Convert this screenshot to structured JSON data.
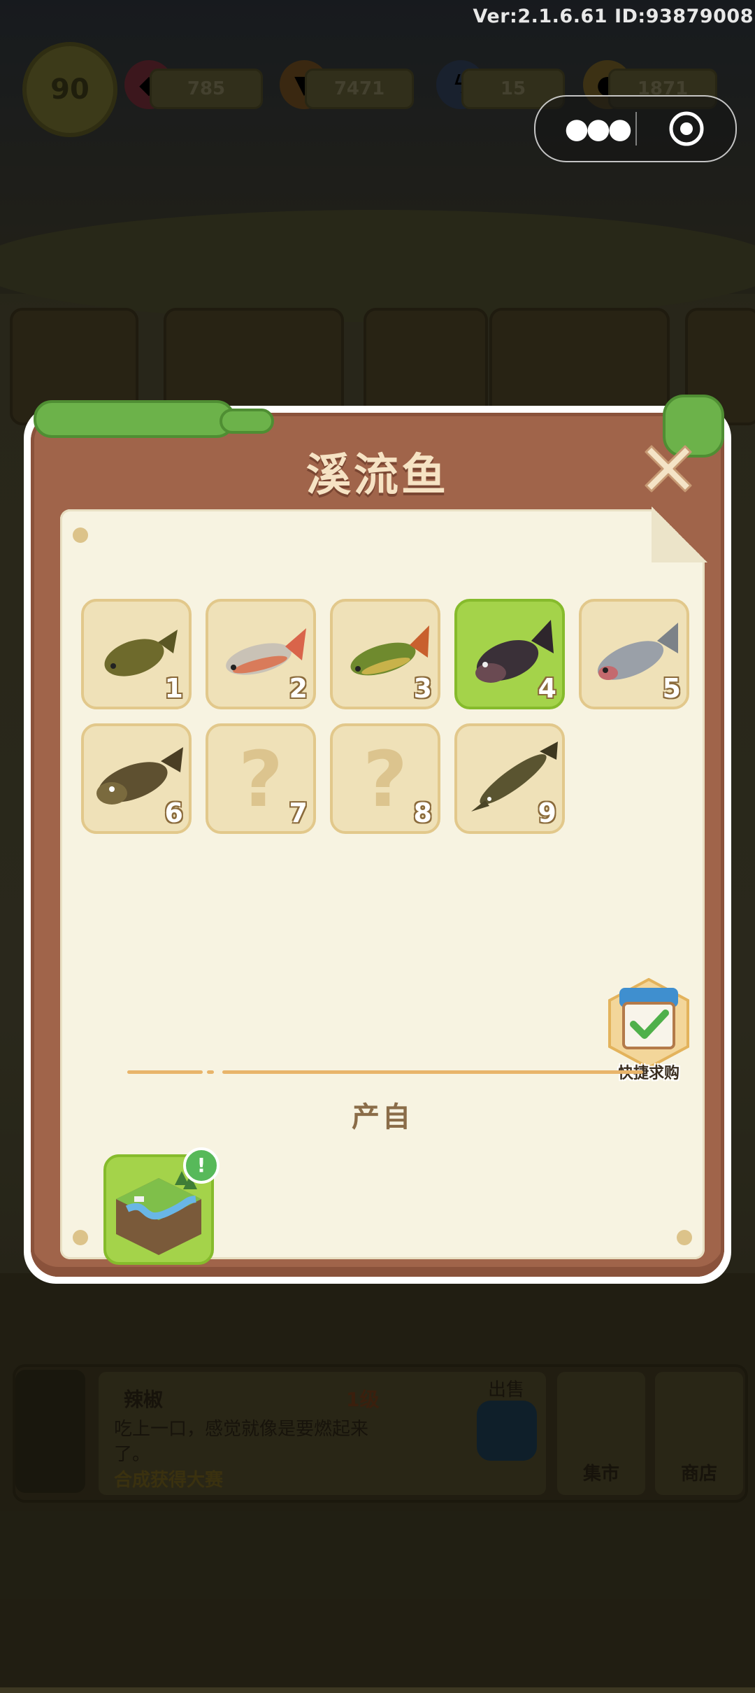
{
  "header": {
    "version_text": "Ver:2.1.6.61 ID:93879008",
    "level": "90",
    "resources": [
      {
        "name": "gem",
        "value": "785"
      },
      {
        "name": "carrot",
        "value": "7471"
      },
      {
        "name": "energy",
        "value": "15"
      },
      {
        "name": "coin",
        "value": "1871"
      }
    ]
  },
  "capsule": {
    "more_icon": "more-dots-icon",
    "close_icon": "target-close-icon"
  },
  "modal": {
    "title": "溪流鱼",
    "close_icon": "close-x-icon",
    "items": [
      {
        "number": "1",
        "status": "unlocked",
        "icon": "fish-1-icon"
      },
      {
        "number": "2",
        "status": "unlocked",
        "icon": "fish-2-icon"
      },
      {
        "number": "3",
        "status": "unlocked",
        "icon": "fish-3-icon"
      },
      {
        "number": "4",
        "status": "selected",
        "icon": "fish-4-icon"
      },
      {
        "number": "5",
        "status": "unlocked",
        "icon": "fish-5-icon"
      },
      {
        "number": "6",
        "status": "unlocked",
        "icon": "fish-6-icon"
      },
      {
        "number": "7",
        "status": "locked",
        "icon": "question-mark-icon",
        "placeholder": "?"
      },
      {
        "number": "8",
        "status": "locked",
        "icon": "question-mark-icon",
        "placeholder": "?"
      },
      {
        "number": "9",
        "status": "unlocked",
        "icon": "sturgeon-icon"
      }
    ],
    "quick_buy_label": "快捷求购",
    "source_title": "产自",
    "source_item": {
      "icon": "stream-tile-icon",
      "badge": "!"
    }
  },
  "background": {
    "item_name": "辣椒",
    "item_level": "1级",
    "item_desc": "吃上一口，感觉就像是要燃起来了。",
    "item_link": "合成获得大赛",
    "sell_label": "出售",
    "market_label": "集市",
    "shop_label": "商店"
  },
  "colors": {
    "wood": "#a0644a",
    "paper": "#f7f3e1",
    "selected_green": "#a4d34a",
    "cell_tan": "#efe1b8"
  }
}
